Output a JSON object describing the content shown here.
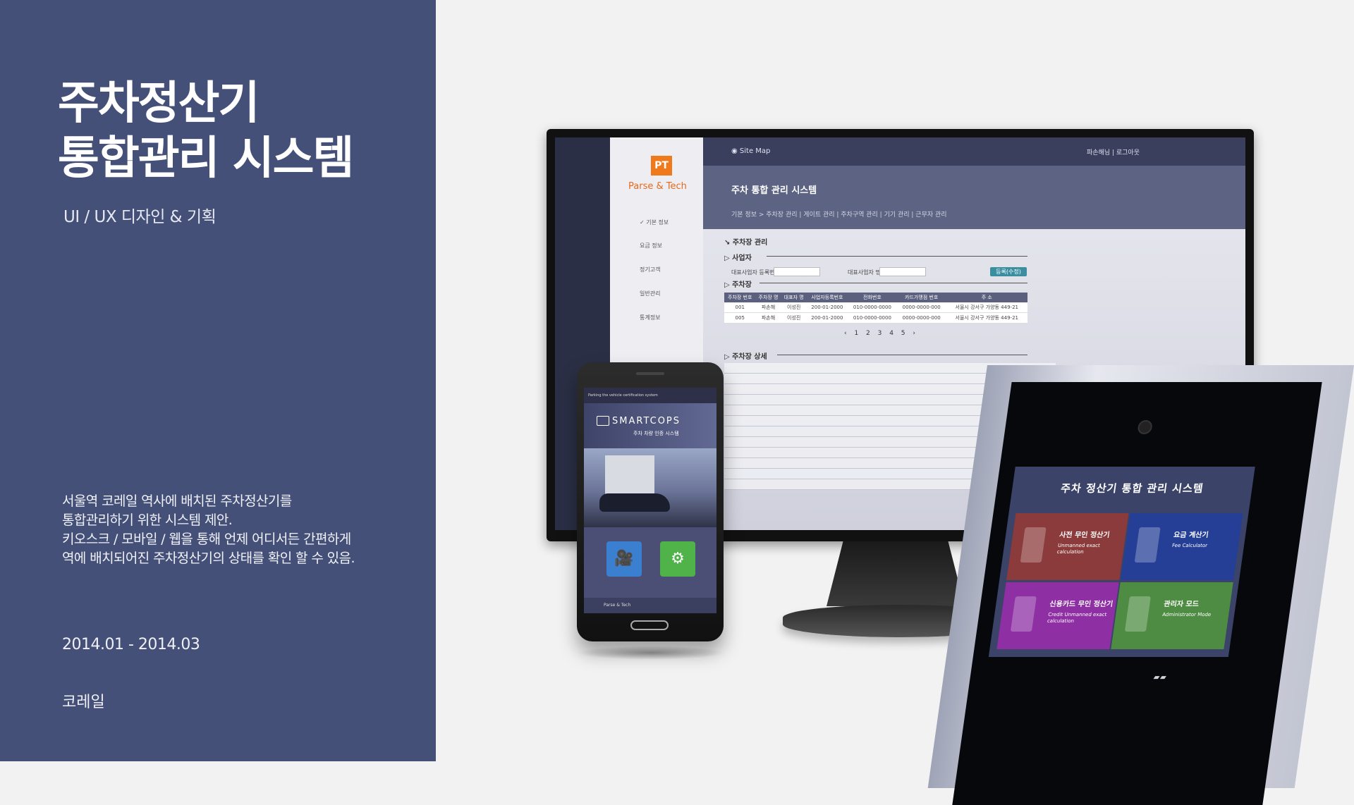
{
  "left_panel": {
    "title_line1": "주차정산기",
    "title_line2": "통합관리 시스템",
    "subtitle": "UI / UX 디자인 & 기획",
    "description": [
      "서울역 코레일 역사에 배치된 주차정산기를",
      "통합관리하기 위한 시스템 제안.",
      "키오스크 / 모바일 / 웹을 통해 언제 어디서든 간편하게",
      "역에 배치되어진 주차정산기의 상태를 확인 할 수 있음."
    ],
    "period": "2014.01 - 2014.03",
    "client": "코레일",
    "bg_color": "#455079"
  },
  "monitor_screen": {
    "logo_text": "PT",
    "brand": "Parse & Tech",
    "sitemap": "Site Map",
    "user_links": "파손해님 | 로그아웃",
    "header_title": "주차 통합 관리 시스템",
    "breadcrumb": "기본 정보  >  주차장 관리 | 게이트 관리 | 주차구역 관리 | 기기 관리 | 근무자 관리",
    "menu": [
      "기본 정보",
      "요금 정보",
      "정기고객",
      "일반관리",
      "통계정보"
    ],
    "section_main": "주차장 관리",
    "section_operator": "사업자",
    "label_biz_no": "대표사업자 등록번호",
    "label_biz_name": "대표사업자 명",
    "register_button": "등록(수정)",
    "section_parking": "주차장",
    "table": {
      "headers": [
        "주차장 번호",
        "주차장 명",
        "대표자 명",
        "사업자등록번호",
        "전화번호",
        "카드가맹점 번호",
        "주 소"
      ],
      "rows": [
        [
          "001",
          "파손해",
          "이성진",
          "200-01-2000",
          "010-0000-0000",
          "0000-0000-000",
          "서울시 강서구 가양동 449-21"
        ],
        [
          "005",
          "파손해",
          "이성진",
          "200-01-2000",
          "010-0000-0000",
          "0000-0000-000",
          "서울시 강서구 가양동 449-21"
        ]
      ]
    },
    "pager": "‹ 1 2 3 4 5 ›",
    "section_detail": "주차장 상세"
  },
  "phone_screen": {
    "status_text": "Parking the vehicle certification system",
    "app_name": "SMARTCOPS",
    "app_sub": "주차 차량 인증 시스템",
    "footer": "Parse & Tech"
  },
  "kiosk_screen": {
    "title": "주차 정산기 통합 관리 시스템",
    "tiles": [
      {
        "title": "사전 무인 정산기",
        "sub": "Unmanned exact calculation",
        "color": "#8b3b3b"
      },
      {
        "title": "요금 계산기",
        "sub": "Fee Calculator",
        "color": "#253f97"
      },
      {
        "title": "신용카드 무인 정산기",
        "sub": "Credit Unmanned exact calculation",
        "color": "#8e2fa3"
      },
      {
        "title": "관리자 모드",
        "sub": "Administrator Mode",
        "color": "#4f8c43"
      }
    ]
  }
}
